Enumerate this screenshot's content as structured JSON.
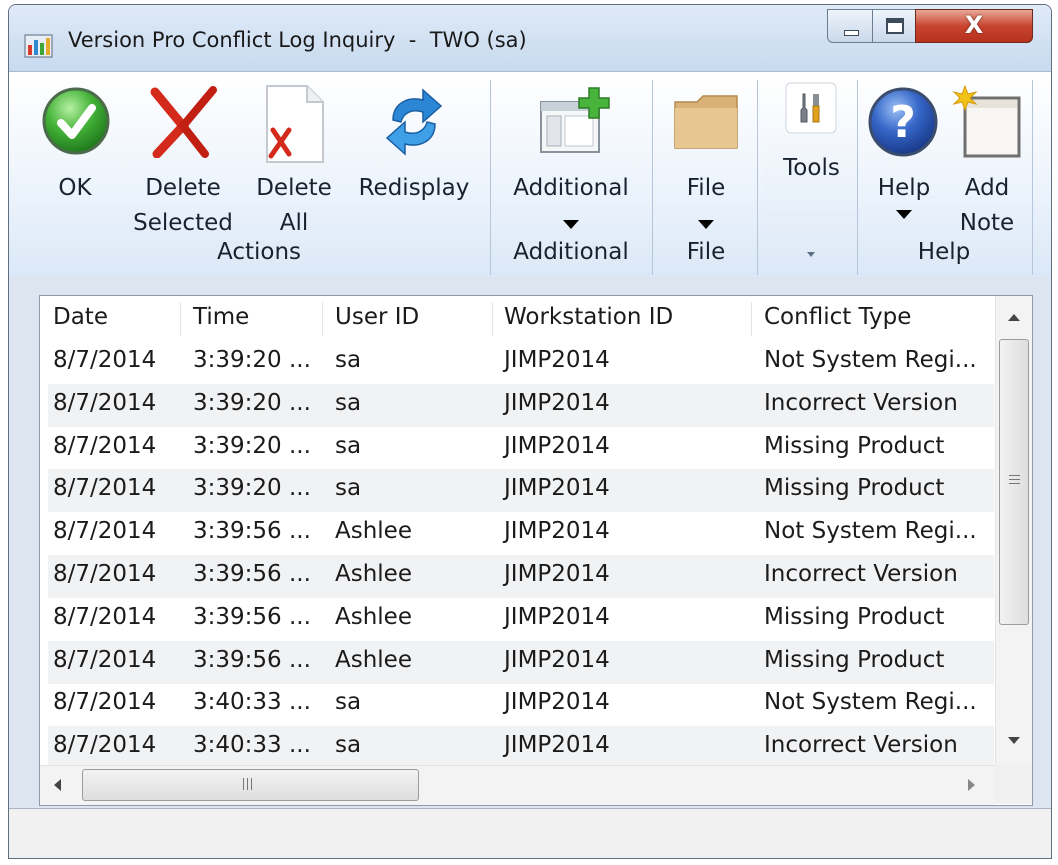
{
  "window": {
    "title": "Version Pro Conflict Log Inquiry  -  TWO (sa)",
    "close_label": "X"
  },
  "ribbon": {
    "ok_label": "OK",
    "delete_selected_line1": "Delete",
    "delete_selected_line2": "Selected",
    "delete_all_line1": "Delete",
    "delete_all_line2": "All",
    "redisplay_label": "Redisplay",
    "additional_label": "Additional",
    "file_label": "File",
    "tools_label": "Tools",
    "help_label": "Help",
    "add_note_line1": "Add",
    "add_note_line2": "Note",
    "groups": {
      "actions": "Actions",
      "additional": "Additional",
      "file": "File",
      "help": "Help"
    },
    "icons": [
      "ok-check-icon",
      "delete-x-icon",
      "delete-all-doc-icon",
      "redisplay-arrows-icon",
      "additional-window-plus-icon",
      "folder-icon",
      "tools-icon",
      "help-question-icon",
      "note-star-icon"
    ]
  },
  "table": {
    "columns": [
      "Date",
      "Time",
      "User ID",
      "Workstation ID",
      "Conflict Type"
    ],
    "rows": [
      [
        "8/7/2014",
        "3:39:20 ...",
        "sa",
        "JIMP2014",
        "Not System Regi..."
      ],
      [
        "8/7/2014",
        "3:39:20 ...",
        "sa",
        "JIMP2014",
        "Incorrect Version"
      ],
      [
        "8/7/2014",
        "3:39:20 ...",
        "sa",
        "JIMP2014",
        "Missing Product"
      ],
      [
        "8/7/2014",
        "3:39:20 ...",
        "sa",
        "JIMP2014",
        "Missing Product"
      ],
      [
        "8/7/2014",
        "3:39:56 ...",
        "Ashlee",
        "JIMP2014",
        "Not System Regi..."
      ],
      [
        "8/7/2014",
        "3:39:56 ...",
        "Ashlee",
        "JIMP2014",
        "Incorrect Version"
      ],
      [
        "8/7/2014",
        "3:39:56 ...",
        "Ashlee",
        "JIMP2014",
        "Missing Product"
      ],
      [
        "8/7/2014",
        "3:39:56 ...",
        "Ashlee",
        "JIMP2014",
        "Missing Product"
      ],
      [
        "8/7/2014",
        "3:40:33 ...",
        "sa",
        "JIMP2014",
        "Not System Regi..."
      ],
      [
        "8/7/2014",
        "3:40:33 ...",
        "sa",
        "JIMP2014",
        "Incorrect Version"
      ]
    ]
  },
  "colors": {
    "ok_green": "#3fa535",
    "delete_red": "#d32a1c",
    "redisplay_blue": "#2b87d6",
    "help_blue": "#2a56b8",
    "close_red": "#c8442e",
    "alt_row": "#f1f2f4"
  }
}
